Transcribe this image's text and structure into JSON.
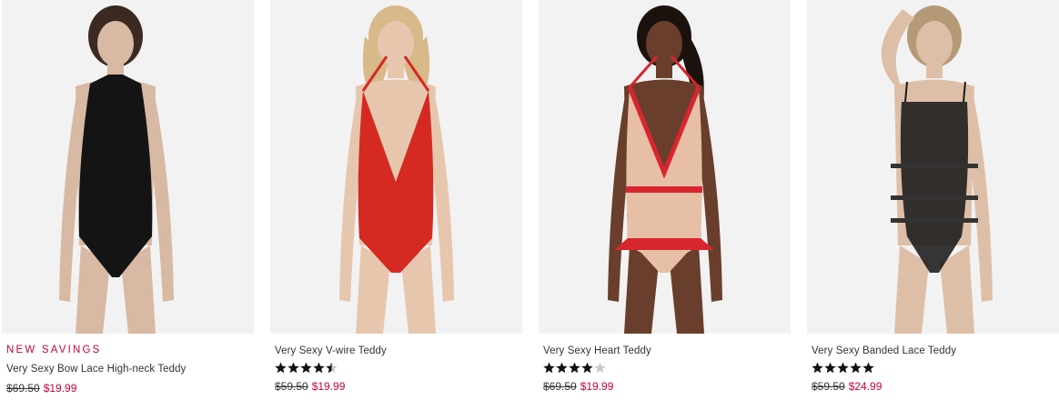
{
  "colors": {
    "sale": "#c6003e",
    "star": "#111111",
    "star_empty": "#cccccc",
    "photo_bg": "#f2f2f2"
  },
  "products": [
    {
      "badge": "NEW SAVINGS",
      "name": "Very Sexy Bow Lace High-neck Teddy",
      "rating": null,
      "was_price": "$69.50",
      "now_price": "$19.99",
      "garment_color": "#141414",
      "skin_color": "#d7b9a4",
      "hair_color": "#3a2a22"
    },
    {
      "badge": "",
      "name": "Very Sexy V-wire Teddy",
      "rating": 4.5,
      "was_price": "$59.50",
      "now_price": "$19.99",
      "garment_color": "#d42a22",
      "skin_color": "#e7c6ae",
      "hair_color": "#d7b98a"
    },
    {
      "badge": "",
      "name": "Very Sexy Heart Teddy",
      "rating": 4,
      "was_price": "$69.50",
      "now_price": "$19.99",
      "garment_color": "#e7bfa6",
      "skin_color": "#6a3e2c",
      "hair_color": "#1c120d"
    },
    {
      "badge": "",
      "name": "Very Sexy Banded Lace Teddy",
      "rating": 5,
      "was_price": "$59.50",
      "now_price": "$24.99",
      "garment_color": "#1a1a1a",
      "skin_color": "#ddbfa8",
      "hair_color": "#b59a78"
    }
  ]
}
